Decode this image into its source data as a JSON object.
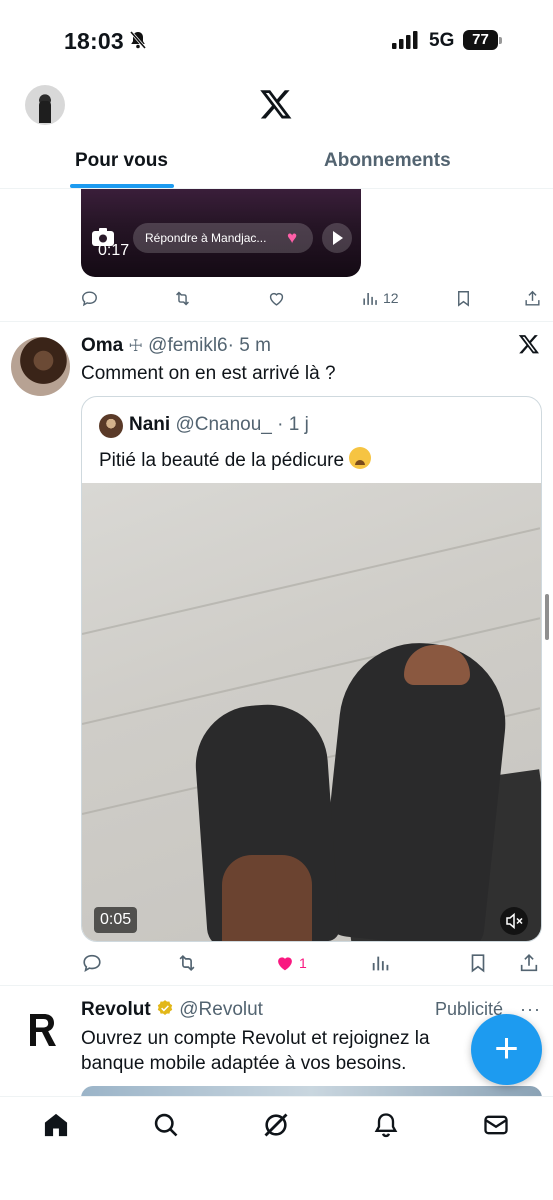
{
  "status_bar": {
    "time": "18:03",
    "network": "5G",
    "battery": "77",
    "icons": [
      "bell-muted-icon",
      "signal-icon",
      "battery-icon"
    ]
  },
  "header": {
    "logo_icon": "x-logo-icon",
    "tabs": [
      {
        "label": "Pour vous",
        "active": true
      },
      {
        "label": "Abonnements",
        "active": false
      }
    ]
  },
  "prev_tweet": {
    "media": {
      "duration": "0:17",
      "reply_placeholder": "Répondre à Mandjac..."
    },
    "actions": {
      "views": "12"
    }
  },
  "tweet": {
    "name": "Oma",
    "name_symbol": "☩",
    "handle": "@femikl6",
    "time": "· 5 m",
    "text": "Comment on en est arrivé là ?",
    "quote": {
      "name": "Nani",
      "handle": "@Cnanou_",
      "time": "· 1 j",
      "text": "Pitié la beauté de la pédicure",
      "video_duration": "0:05"
    },
    "actions": {
      "likes": "1",
      "liked": true
    }
  },
  "ad": {
    "name": "Revolut",
    "handle": "@Revolut",
    "label": "Publicité",
    "more": "···",
    "text": "Ouvrez un compte Revolut et rejoignez la banque mobile adaptée à vos besoins.",
    "verified_color": "#e2b719"
  },
  "fab_label": "+",
  "colors": {
    "accent": "#1d9bf0",
    "like": "#f91880",
    "secondary_text": "#536471"
  },
  "bottom_nav": [
    "home-icon",
    "search-icon",
    "grok-icon",
    "notifications-icon",
    "messages-icon"
  ]
}
